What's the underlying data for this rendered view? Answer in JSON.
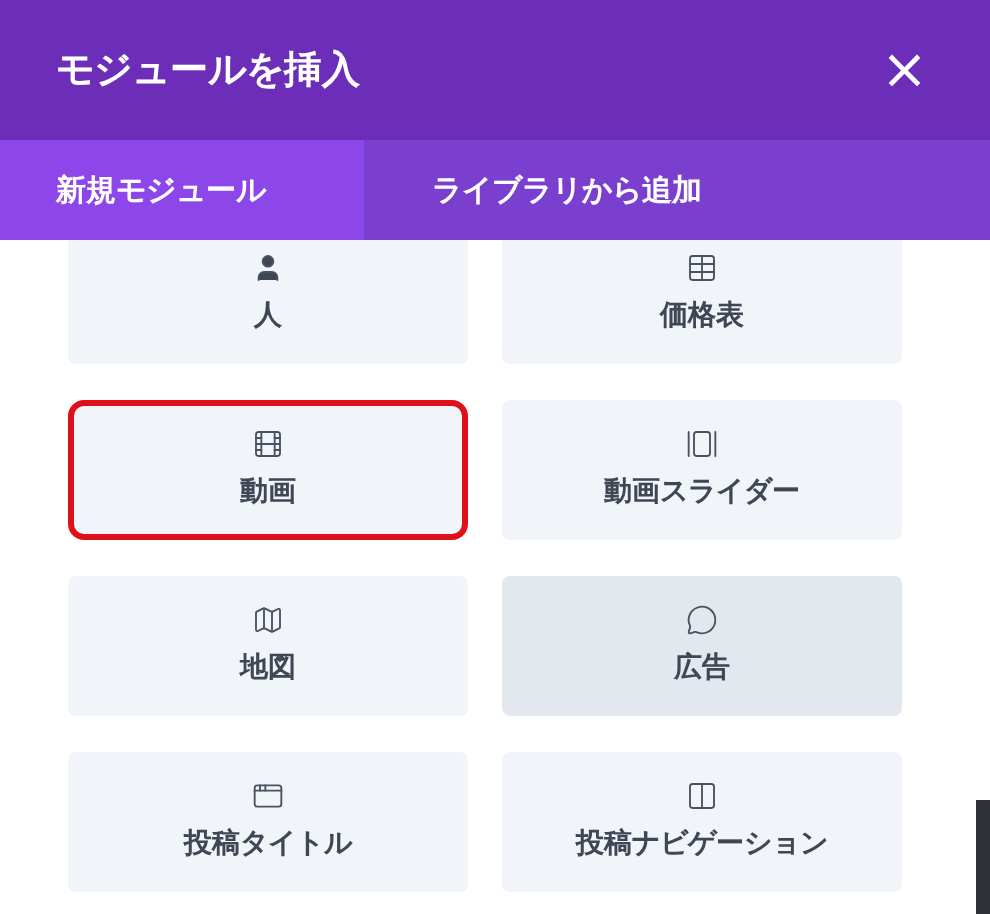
{
  "window": {
    "title": "モジュールを挿入",
    "close": "×"
  },
  "tabs": [
    {
      "label": "新規モジュール",
      "selected": true
    },
    {
      "label": "ライブラリから追加",
      "selected": false
    }
  ],
  "modules": [
    {
      "label": "人",
      "kind": "person",
      "highlighted": false,
      "hovered": false
    },
    {
      "label": "価格表",
      "kind": "pricing",
      "highlighted": false,
      "hovered": false
    },
    {
      "label": "動画",
      "kind": "video",
      "highlighted": true,
      "hovered": false
    },
    {
      "label": "動画スライダー",
      "kind": "video-slider",
      "highlighted": false,
      "hovered": false
    },
    {
      "label": "地図",
      "kind": "map",
      "highlighted": false,
      "hovered": false
    },
    {
      "label": "広告",
      "kind": "ad",
      "highlighted": false,
      "hovered": true
    },
    {
      "label": "投稿タイトル",
      "kind": "post-title",
      "highlighted": false,
      "hovered": false
    },
    {
      "label": "投稿ナビゲーション",
      "kind": "post-nav",
      "highlighted": false,
      "hovered": false
    }
  ]
}
